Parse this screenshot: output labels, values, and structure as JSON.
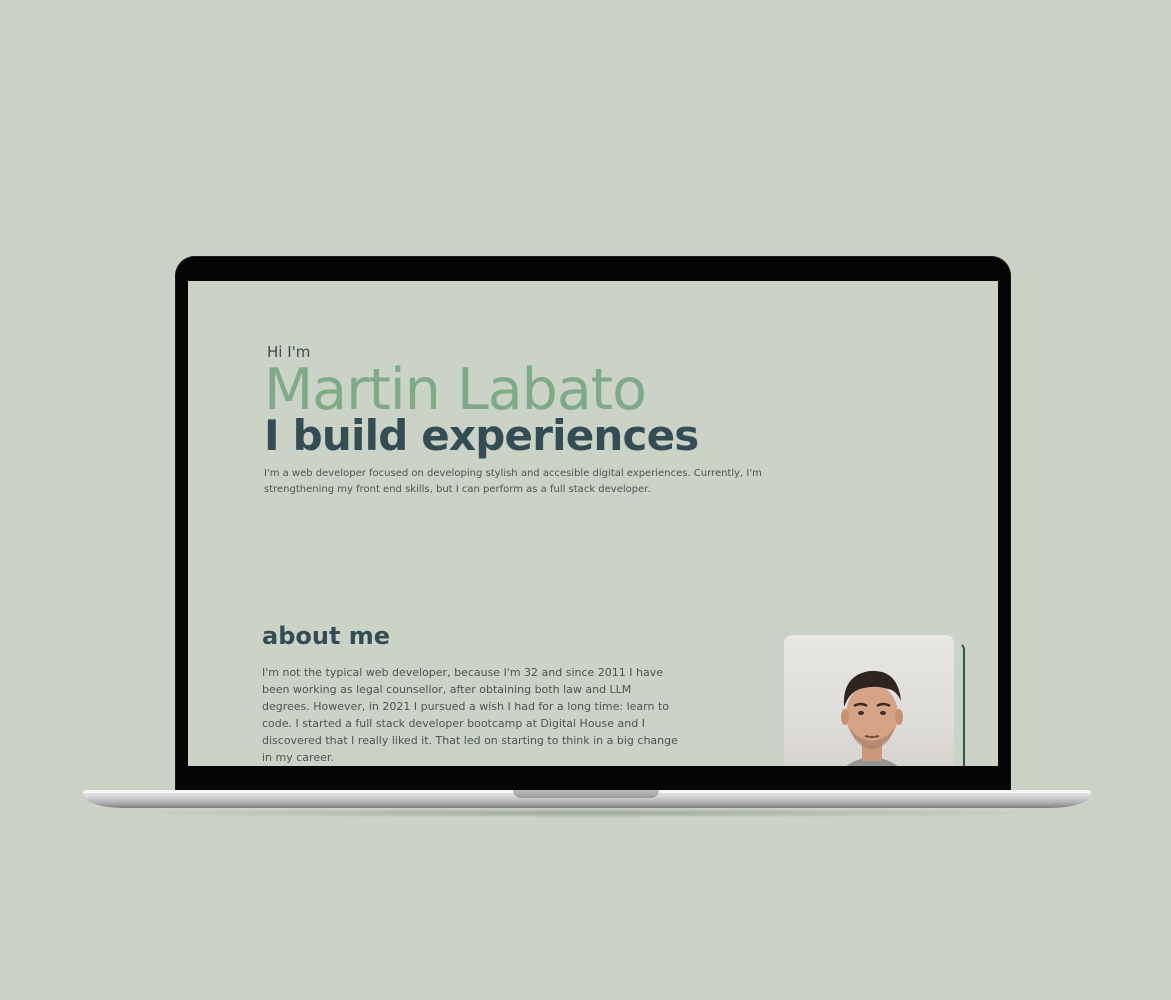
{
  "background_color": "#cad3c6",
  "site": {
    "greeting": "Hi I'm",
    "name": "Martin Labato",
    "tagline": "I build experiences",
    "intro": "I'm a web developer focused on developing stylish and accesible digital experiences. Currently, I'm strengthening my front end skills, but I can perform as a full stack developer.",
    "about": {
      "title": "about me",
      "text": "I'm not the typical web developer, because I'm 32 and since 2011 I have been working as legal counsellor, after obtaining both law and LLM degrees. However, in 2021 I pursued a wish I had for a long time: learn to code. I started a full stack developer bootcamp at Digital House and I discovered that I really liked it. That led on starting to think in a big change in my career."
    },
    "colors": {
      "name": "#7faa87",
      "heading": "#344d55",
      "body": "#4a5454"
    }
  }
}
